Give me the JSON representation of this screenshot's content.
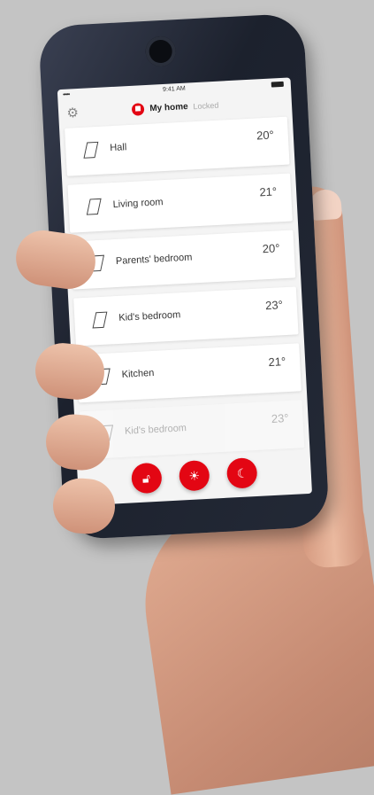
{
  "statusbar": {
    "signal": "•••••",
    "time": "9:41 AM"
  },
  "header": {
    "home_name": "My home",
    "home_status": "Locked"
  },
  "rooms": [
    {
      "name": "Hall",
      "temp": "20°"
    },
    {
      "name": "Living room",
      "temp": "21°"
    },
    {
      "name": "Parents' bedroom",
      "temp": "20°"
    },
    {
      "name": "Kid's bedroom",
      "temp": "23°"
    },
    {
      "name": "Kitchen",
      "temp": "21°"
    },
    {
      "name": "Kid's bedroom",
      "temp": "23°"
    }
  ],
  "actions": {
    "unlock_icon": "unlock-icon",
    "sun_icon": "sun-icon",
    "moon_icon": "moon-icon"
  },
  "colors": {
    "accent": "#e30613",
    "background": "#c4c4c4",
    "phone_body": "#1c212d"
  }
}
